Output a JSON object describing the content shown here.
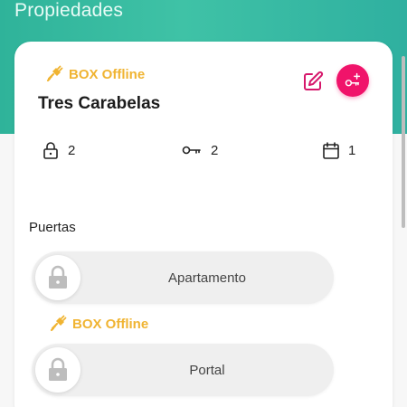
{
  "header": {
    "title": "Propiedades"
  },
  "property": {
    "status": "BOX Offline",
    "name": "Tres Carabelas",
    "stats": {
      "locks": "2",
      "keys": "2",
      "calendar": "1"
    }
  },
  "doors": {
    "section_label": "Puertas",
    "items": [
      {
        "label": "Apartamento"
      },
      {
        "label": "Portal",
        "status": "BOX Offline"
      }
    ]
  },
  "colors": {
    "accent": "#f0136a",
    "status": "#f0b432",
    "header": "#3fc2a6"
  },
  "icons": [
    "plug-icon",
    "edit-icon",
    "add-key-icon",
    "lock-icon",
    "key-icon",
    "calendar-icon"
  ]
}
